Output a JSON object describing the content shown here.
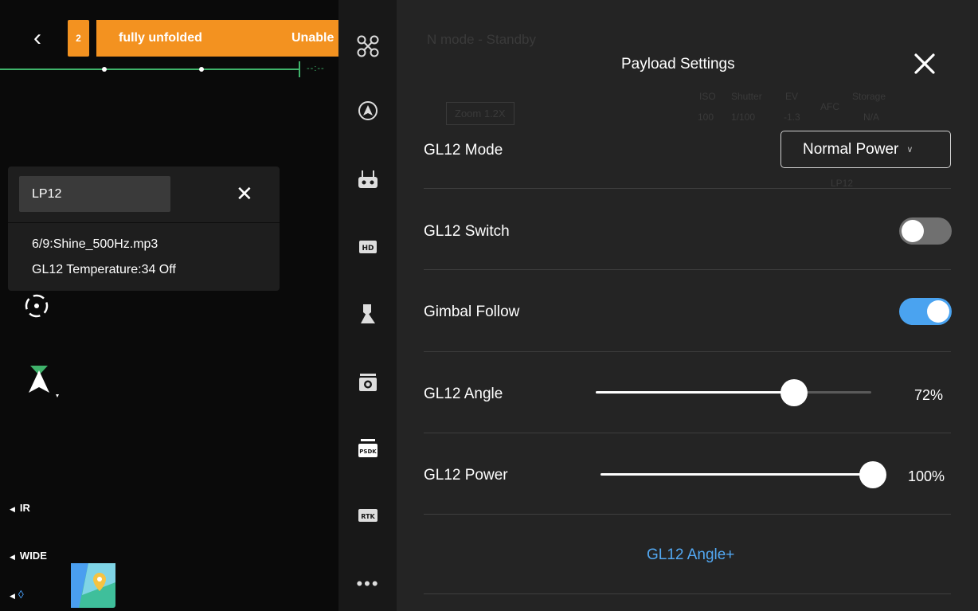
{
  "warning": {
    "count": "2",
    "message": "fully unfolded",
    "message2": "Unable"
  },
  "lp_panel": {
    "field_value": "LP12",
    "line1": "6/9:Shine_500Hz.mp3",
    "line2": "GL12 Temperature:34 Off"
  },
  "camera_labels": {
    "ir": "IR",
    "wide": "WIDE"
  },
  "icons": {
    "drone": "drone-icon",
    "autopilot": "autopilot-icon",
    "controller": "remote-controller-icon",
    "hd": "hd-icon",
    "pin": "pin-icon",
    "camera": "camera-icon",
    "psdk": "psdk-icon",
    "rtk": "rtk-icon",
    "more": "more-icon"
  },
  "icon_labels": {
    "hd": "HD",
    "psdk": "PSDK",
    "rtk": "RTK"
  },
  "background_status": {
    "mode": "N mode - Standby",
    "zoom": "Zoom 1.2X",
    "iso_label": "ISO",
    "iso_value": "100",
    "shutter_label": "Shutter",
    "shutter_value": "1/100",
    "ev_label": "EV",
    "ev_value": "-1.3",
    "afc_label": "AFC",
    "storage_label": "Storage",
    "storage_value": "N/A",
    "camera_name": "LP12"
  },
  "settings": {
    "title": "Payload Settings",
    "mode_label": "GL12 Mode",
    "mode_value": "Normal Power",
    "switch_label": "GL12 Switch",
    "switch_on": false,
    "follow_label": "Gimbal Follow",
    "follow_on": true,
    "angle_label": "GL12 Angle",
    "angle_value": "72%",
    "angle_fraction": 0.72,
    "power_label": "GL12 Power",
    "power_value": "100%",
    "power_fraction": 1.0,
    "angle_plus_label": "GL12 Angle+"
  },
  "colors": {
    "warning_orange": "#f39220",
    "toggle_on_blue": "#4aa3f0",
    "toggle_off_gray": "#707070",
    "link_blue": "#52a8f2",
    "track_green": "#3fb36b"
  }
}
